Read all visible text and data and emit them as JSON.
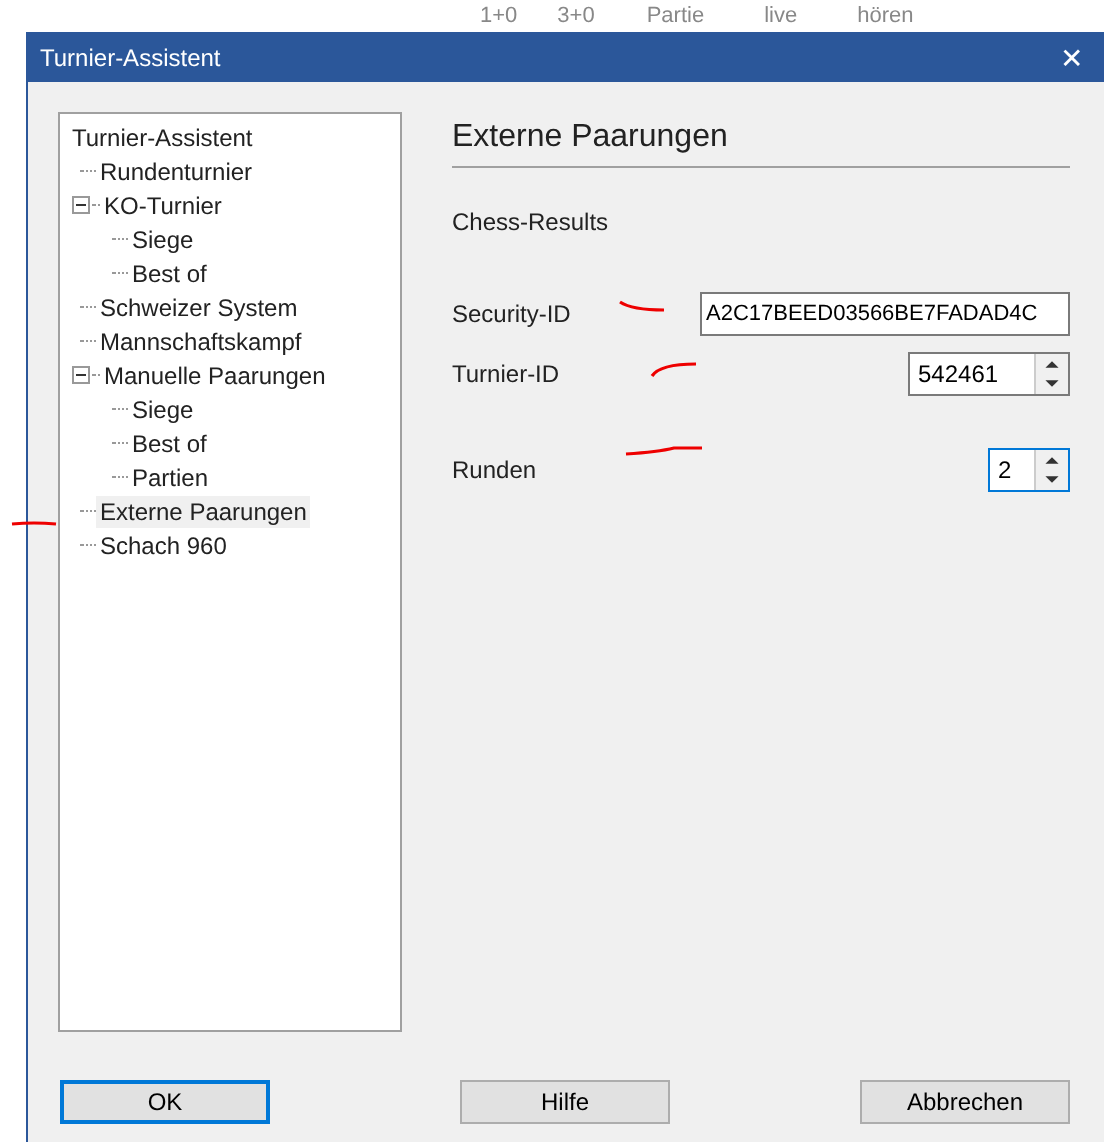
{
  "background": {
    "header_cells": [
      "1+0",
      "3+0",
      "Partie",
      "live",
      "hören"
    ]
  },
  "window": {
    "title": "Turnier-Assistent",
    "close": "✕"
  },
  "tree": [
    {
      "label": "Turnier-Assistent",
      "selected": false,
      "children": [
        {
          "label": "Rundenturnier",
          "selected": false
        },
        {
          "label": "KO-Turnier",
          "selected": false,
          "expanded": true,
          "children": [
            {
              "label": "Siege",
              "selected": false
            },
            {
              "label": "Best of",
              "selected": false
            }
          ]
        },
        {
          "label": "Schweizer System",
          "selected": false
        },
        {
          "label": "Mannschaftskampf",
          "selected": false
        },
        {
          "label": "Manuelle Paarungen",
          "selected": false,
          "expanded": true,
          "children": [
            {
              "label": "Siege",
              "selected": false
            },
            {
              "label": "Best of",
              "selected": false
            },
            {
              "label": "Partien",
              "selected": false
            }
          ]
        },
        {
          "label": "Externe Paarungen",
          "selected": true
        },
        {
          "label": "Schach 960",
          "selected": false
        }
      ]
    }
  ],
  "panel": {
    "heading": "Externe Paarungen",
    "subheading": "Chess-Results",
    "fields": [
      {
        "kind": "text",
        "label": "Security-ID",
        "value": "A2C17BEED03566BE7FADAD4C",
        "focused": false
      },
      {
        "kind": "spin",
        "label": "Turnier-ID",
        "value": "542461",
        "focused": false
      },
      {
        "kind": "spin",
        "label": "Runden",
        "value": "2",
        "focused": true
      }
    ]
  },
  "buttons": [
    {
      "label": "OK",
      "default": true
    },
    {
      "label": "Hilfe",
      "default": false
    },
    {
      "label": "Abbrechen",
      "default": false
    }
  ]
}
